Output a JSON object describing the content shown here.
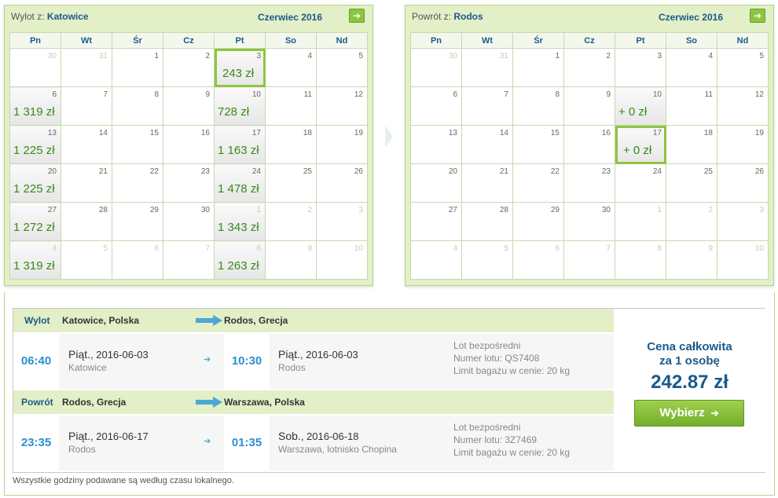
{
  "outbound": {
    "prefix": "Wylot z:",
    "city": "Katowice",
    "month": "Czerwiec 2016",
    "next_icon": "arrow-right-icon",
    "weekdays": [
      "Pn",
      "Wt",
      "Śr",
      "Cz",
      "Pt",
      "So",
      "Nd"
    ],
    "weeks": [
      [
        {
          "d": "30",
          "o": true
        },
        {
          "d": "31",
          "o": true
        },
        {
          "d": "1"
        },
        {
          "d": "2"
        },
        {
          "d": "3",
          "p": "243 zł",
          "s": true
        },
        {
          "d": "4"
        },
        {
          "d": "5"
        }
      ],
      [
        {
          "d": "6",
          "p": "1 319 zł"
        },
        {
          "d": "7"
        },
        {
          "d": "8"
        },
        {
          "d": "9"
        },
        {
          "d": "10",
          "p": "728 zł"
        },
        {
          "d": "11"
        },
        {
          "d": "12"
        }
      ],
      [
        {
          "d": "13",
          "p": "1 225 zł"
        },
        {
          "d": "14"
        },
        {
          "d": "15"
        },
        {
          "d": "16"
        },
        {
          "d": "17",
          "p": "1 163 zł"
        },
        {
          "d": "18"
        },
        {
          "d": "19"
        }
      ],
      [
        {
          "d": "20",
          "p": "1 225 zł"
        },
        {
          "d": "21"
        },
        {
          "d": "22"
        },
        {
          "d": "23"
        },
        {
          "d": "24",
          "p": "1 478 zł"
        },
        {
          "d": "25"
        },
        {
          "d": "26"
        }
      ],
      [
        {
          "d": "27",
          "p": "1 272 zł"
        },
        {
          "d": "28"
        },
        {
          "d": "29"
        },
        {
          "d": "30"
        },
        {
          "d": "1",
          "o": true,
          "p": "1 343 zł"
        },
        {
          "d": "2",
          "o": true
        },
        {
          "d": "3",
          "o": true
        }
      ],
      [
        {
          "d": "4",
          "o": true,
          "p": "1 319 zł"
        },
        {
          "d": "5",
          "o": true
        },
        {
          "d": "6",
          "o": true
        },
        {
          "d": "7",
          "o": true
        },
        {
          "d": "8",
          "o": true,
          "p": "1 263 zł"
        },
        {
          "d": "9",
          "o": true
        },
        {
          "d": "10",
          "o": true
        }
      ]
    ]
  },
  "return": {
    "prefix": "Powrót z:",
    "city": "Rodos",
    "month": "Czerwiec 2016",
    "next_icon": "arrow-right-icon",
    "weekdays": [
      "Pn",
      "Wt",
      "Śr",
      "Cz",
      "Pt",
      "So",
      "Nd"
    ],
    "weeks": [
      [
        {
          "d": "30",
          "o": true
        },
        {
          "d": "31",
          "o": true
        },
        {
          "d": "1"
        },
        {
          "d": "2"
        },
        {
          "d": "3"
        },
        {
          "d": "4"
        },
        {
          "d": "5"
        }
      ],
      [
        {
          "d": "6"
        },
        {
          "d": "7"
        },
        {
          "d": "8"
        },
        {
          "d": "9"
        },
        {
          "d": "10",
          "p": "+ 0 zł"
        },
        {
          "d": "11"
        },
        {
          "d": "12"
        }
      ],
      [
        {
          "d": "13"
        },
        {
          "d": "14"
        },
        {
          "d": "15"
        },
        {
          "d": "16"
        },
        {
          "d": "17",
          "p": "+ 0 zł",
          "s": true
        },
        {
          "d": "18"
        },
        {
          "d": "19"
        }
      ],
      [
        {
          "d": "20"
        },
        {
          "d": "21"
        },
        {
          "d": "22"
        },
        {
          "d": "23"
        },
        {
          "d": "24"
        },
        {
          "d": "25"
        },
        {
          "d": "26"
        }
      ],
      [
        {
          "d": "27"
        },
        {
          "d": "28"
        },
        {
          "d": "29"
        },
        {
          "d": "30"
        },
        {
          "d": "1",
          "o": true
        },
        {
          "d": "2",
          "o": true
        },
        {
          "d": "3",
          "o": true
        }
      ],
      [
        {
          "d": "4",
          "o": true
        },
        {
          "d": "5",
          "o": true
        },
        {
          "d": "6",
          "o": true
        },
        {
          "d": "7",
          "o": true
        },
        {
          "d": "8",
          "o": true
        },
        {
          "d": "9",
          "o": true
        },
        {
          "d": "10",
          "o": true
        }
      ]
    ]
  },
  "summary": {
    "out": {
      "label": "Wylot",
      "from": "Katowice, Polska",
      "to": "Rodos, Grecja",
      "dep_time": "06:40",
      "dep_day": "Piąt.",
      "dep_date": ", 2016-06-03",
      "dep_city": "Katowice",
      "arr_time": "10:30",
      "arr_day": "Piąt.",
      "arr_date": ", 2016-06-03",
      "arr_city": "Rodos",
      "info1": "Lot bezpośredni",
      "info2": "Numer lotu: QS7408",
      "info3": "Limit bagażu w cenie: 20 kg"
    },
    "ret": {
      "label": "Powrót",
      "from": "Rodos, Grecja",
      "to": "Warszawa, Polska",
      "dep_time": "23:35",
      "dep_day": "Piąt.",
      "dep_date": ", 2016-06-17",
      "dep_city": "Rodos",
      "arr_time": "01:35",
      "arr_day": "Sob.",
      "arr_date": ", 2016-06-18",
      "arr_city": "Warszawa, lotnisko Chopina",
      "info1": "Lot bezpośredni",
      "info2": "Numer lotu: 3Z7469",
      "info3": "Limit bagażu w cenie: 20 kg"
    },
    "price_label_1": "Cena całkowita",
    "price_label_2": "za 1 osobę",
    "price_total": "242.87 zł",
    "choose_label": "Wybierz"
  },
  "footer_note": "Wszystkie godziny podawane są według czasu lokalnego.",
  "colors": {
    "accent_green": "#8cc63f",
    "price_green": "#3a8a1a",
    "link_blue": "#1a5a8a",
    "time_blue": "#2a90d0"
  }
}
